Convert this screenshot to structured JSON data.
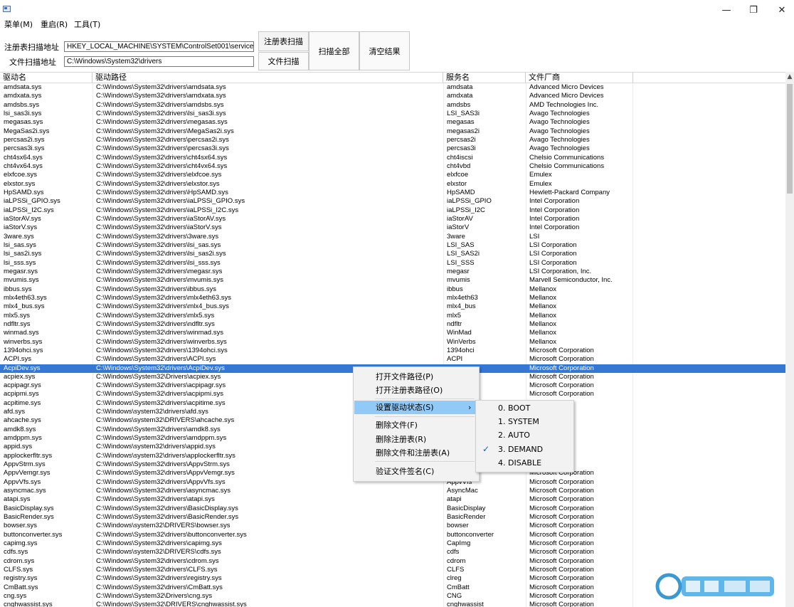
{
  "window": {
    "minimize": "—",
    "restore": "❐",
    "close": "✕"
  },
  "menu": {
    "items": [
      "菜单(M)",
      "重启(R)",
      "工具(T)"
    ]
  },
  "scan": {
    "registry_label": "注册表扫描地址",
    "registry_path": "HKEY_LOCAL_MACHINE\\SYSTEM\\ControlSet001\\services",
    "file_label": "文件扫描地址",
    "file_path": "C:\\Windows\\System32\\drivers",
    "btn_registry_scan": "注册表扫描",
    "btn_file_scan": "文件扫描",
    "btn_scan_all": "扫描全部",
    "btn_clear": "清空结果"
  },
  "table": {
    "columns": [
      "驱动名",
      "驱动路径",
      "服务名",
      "文件厂商"
    ],
    "rows": [
      [
        "amdsata.sys",
        "C:\\Windows\\System32\\drivers\\amdsata.sys",
        "amdsata",
        "Advanced Micro Devices"
      ],
      [
        "amdxata.sys",
        "C:\\Windows\\System32\\drivers\\amdxata.sys",
        "amdxata",
        "Advanced Micro Devices"
      ],
      [
        "amdsbs.sys",
        "C:\\Windows\\System32\\drivers\\amdsbs.sys",
        "amdsbs",
        "AMD Technologies Inc."
      ],
      [
        "lsi_sas3i.sys",
        "C:\\Windows\\System32\\drivers\\lsi_sas3i.sys",
        "LSI_SAS3i",
        "Avago Technologies"
      ],
      [
        "megasas.sys",
        "C:\\Windows\\System32\\drivers\\megasas.sys",
        "megasas",
        "Avago Technologies"
      ],
      [
        "MegaSas2i.sys",
        "C:\\Windows\\System32\\drivers\\MegaSas2i.sys",
        "megasas2i",
        "Avago Technologies"
      ],
      [
        "percsas2i.sys",
        "C:\\Windows\\System32\\drivers\\percsas2i.sys",
        "percsas2i",
        "Avago Technologies"
      ],
      [
        "percsas3i.sys",
        "C:\\Windows\\System32\\drivers\\percsas3i.sys",
        "percsas3i",
        "Avago Technologies"
      ],
      [
        "cht4sx64.sys",
        "C:\\Windows\\System32\\drivers\\cht4sx64.sys",
        "cht4iscsi",
        "Chelsio Communications"
      ],
      [
        "cht4vx64.sys",
        "C:\\Windows\\System32\\drivers\\cht4vx64.sys",
        "cht4vbd",
        "Chelsio Communications"
      ],
      [
        "elxfcoe.sys",
        "C:\\Windows\\System32\\drivers\\elxfcoe.sys",
        "elxfcoe",
        "Emulex"
      ],
      [
        "elxstor.sys",
        "C:\\Windows\\System32\\drivers\\elxstor.sys",
        "elxstor",
        "Emulex"
      ],
      [
        "HpSAMD.sys",
        "C:\\Windows\\System32\\drivers\\HpSAMD.sys",
        "HpSAMD",
        "Hewlett-Packard Company"
      ],
      [
        "iaLPSSi_GPIO.sys",
        "C:\\Windows\\System32\\drivers\\iaLPSSi_GPIO.sys",
        "iaLPSSi_GPIO",
        "Intel Corporation"
      ],
      [
        "iaLPSSi_I2C.sys",
        "C:\\Windows\\System32\\drivers\\iaLPSSi_I2C.sys",
        "iaLPSSi_I2C",
        "Intel Corporation"
      ],
      [
        "iaStorAV.sys",
        "C:\\Windows\\System32\\drivers\\iaStorAV.sys",
        "iaStorAV",
        "Intel Corporation"
      ],
      [
        "iaStorV.sys",
        "C:\\Windows\\System32\\drivers\\iaStorV.sys",
        "iaStorV",
        "Intel Corporation"
      ],
      [
        "3ware.sys",
        "C:\\Windows\\System32\\drivers\\3ware.sys",
        "3ware",
        "LSI"
      ],
      [
        "lsi_sas.sys",
        "C:\\Windows\\System32\\drivers\\lsi_sas.sys",
        "LSI_SAS",
        "LSI Corporation"
      ],
      [
        "lsi_sas2i.sys",
        "C:\\Windows\\System32\\drivers\\lsi_sas2i.sys",
        "LSI_SAS2i",
        "LSI Corporation"
      ],
      [
        "lsi_sss.sys",
        "C:\\Windows\\System32\\drivers\\lsi_sss.sys",
        "LSI_SSS",
        "LSI Corporation"
      ],
      [
        "megasr.sys",
        "C:\\Windows\\System32\\drivers\\megasr.sys",
        "megasr",
        "LSI Corporation, Inc."
      ],
      [
        "mvumis.sys",
        "C:\\Windows\\System32\\drivers\\mvumis.sys",
        "mvumis",
        "Marvell Semiconductor, Inc."
      ],
      [
        "ibbus.sys",
        "C:\\Windows\\System32\\drivers\\ibbus.sys",
        "ibbus",
        "Mellanox"
      ],
      [
        "mlx4eth63.sys",
        "C:\\Windows\\System32\\drivers\\mlx4eth63.sys",
        "mlx4eth63",
        "Mellanox"
      ],
      [
        "mlx4_bus.sys",
        "C:\\Windows\\System32\\drivers\\mlx4_bus.sys",
        "mlx4_bus",
        "Mellanox"
      ],
      [
        "mlx5.sys",
        "C:\\Windows\\System32\\drivers\\mlx5.sys",
        "mlx5",
        "Mellanox"
      ],
      [
        "ndfltr.sys",
        "C:\\Windows\\System32\\drivers\\ndfltr.sys",
        "ndfltr",
        "Mellanox"
      ],
      [
        "winmad.sys",
        "C:\\Windows\\System32\\drivers\\winmad.sys",
        "WinMad",
        "Mellanox"
      ],
      [
        "winverbs.sys",
        "C:\\Windows\\System32\\drivers\\winverbs.sys",
        "WinVerbs",
        "Mellanox"
      ],
      [
        "1394ohci.sys",
        "C:\\Windows\\System32\\drivers\\1394ohci.sys",
        "1394ohci",
        "Microsoft Corporation"
      ],
      [
        "ACPI.sys",
        "C:\\Windows\\System32\\drivers\\ACPI.sys",
        "ACPI",
        "Microsoft Corporation"
      ],
      [
        "AcpiDev.sys",
        "C:\\Windows\\System32\\drivers\\AcpiDev.sys",
        "",
        "Microsoft Corporation"
      ],
      [
        "acpiex.sys",
        "C:\\Windows\\System32\\Drivers\\acpiex.sys",
        "",
        "Microsoft Corporation"
      ],
      [
        "acpipagr.sys",
        "C:\\Windows\\System32\\drivers\\acpipagr.sys",
        "",
        "Microsoft Corporation"
      ],
      [
        "acpipmi.sys",
        "C:\\Windows\\System32\\drivers\\acpipmi.sys",
        "",
        "Microsoft Corporation"
      ],
      [
        "acpitime.sys",
        "C:\\Windows\\System32\\drivers\\acpitime.sys",
        "",
        "oration"
      ],
      [
        "afd.sys",
        "C:\\Windows\\system32\\drivers\\afd.sys",
        "",
        "oration"
      ],
      [
        "ahcache.sys",
        "C:\\Windows\\system32\\DRIVERS\\ahcache.sys",
        "",
        "oration"
      ],
      [
        "amdk8.sys",
        "C:\\Windows\\System32\\drivers\\amdk8.sys",
        "",
        "oration"
      ],
      [
        "amdppm.sys",
        "C:\\Windows\\System32\\drivers\\amdppm.sys",
        "",
        "oration"
      ],
      [
        "appid.sys",
        "C:\\Windows\\system32\\drivers\\appid.sys",
        "",
        "oration"
      ],
      [
        "applockerfltr.sys",
        "C:\\Windows\\system32\\drivers\\applockerfltr.sys",
        "",
        "oration"
      ],
      [
        "AppvStrm.sys",
        "C:\\Windows\\System32\\drivers\\AppvStrm.sys",
        "",
        "oration"
      ],
      [
        "AppvVemgr.sys",
        "C:\\Windows\\System32\\drivers\\AppvVemgr.sys",
        "",
        "Microsoft Corporation"
      ],
      [
        "AppvVfs.sys",
        "C:\\Windows\\System32\\drivers\\AppvVfs.sys",
        "AppvVfs",
        "Microsoft Corporation"
      ],
      [
        "asyncmac.sys",
        "C:\\Windows\\System32\\drivers\\asyncmac.sys",
        "AsyncMac",
        "Microsoft Corporation"
      ],
      [
        "atapi.sys",
        "C:\\Windows\\System32\\drivers\\atapi.sys",
        "atapi",
        "Microsoft Corporation"
      ],
      [
        "BasicDisplay.sys",
        "C:\\Windows\\System32\\drivers\\BasicDisplay.sys",
        "BasicDisplay",
        "Microsoft Corporation"
      ],
      [
        "BasicRender.sys",
        "C:\\Windows\\System32\\drivers\\BasicRender.sys",
        "BasicRender",
        "Microsoft Corporation"
      ],
      [
        "bowser.sys",
        "C:\\Windows\\system32\\DRIVERS\\bowser.sys",
        "bowser",
        "Microsoft Corporation"
      ],
      [
        "buttonconverter.sys",
        "C:\\Windows\\System32\\drivers\\buttonconverter.sys",
        "buttonconverter",
        "Microsoft Corporation"
      ],
      [
        "capimg.sys",
        "C:\\Windows\\System32\\drivers\\capimg.sys",
        "CapImg",
        "Microsoft Corporation"
      ],
      [
        "cdfs.sys",
        "C:\\Windows\\system32\\DRIVERS\\cdfs.sys",
        "cdfs",
        "Microsoft Corporation"
      ],
      [
        "cdrom.sys",
        "C:\\Windows\\System32\\drivers\\cdrom.sys",
        "cdrom",
        "Microsoft Corporation"
      ],
      [
        "CLFS.sys",
        "C:\\Windows\\System32\\drivers\\CLFS.sys",
        "CLFS",
        "Microsoft Corporation"
      ],
      [
        "registry.sys",
        "C:\\Windows\\System32\\drivers\\registry.sys",
        "clreg",
        "Microsoft Corporation"
      ],
      [
        "CmBatt.sys",
        "C:\\Windows\\System32\\drivers\\CmBatt.sys",
        "CmBatt",
        "Microsoft Corporation"
      ],
      [
        "cng.sys",
        "C:\\Windows\\System32\\Drivers\\cng.sys",
        "CNG",
        "Microsoft Corporation"
      ],
      [
        "cnghwassist.sys",
        "C:\\Windows\\System32\\DRIVERS\\cnghwassist.sys",
        "cnghwassist",
        "Microsoft Corporation"
      ]
    ],
    "selected_row": 32
  },
  "context_menu": {
    "items": [
      "打开文件路径(P)",
      "打开注册表路径(O)",
      "设置驱动状态(S)",
      "删除文件(F)",
      "删除注册表(R)",
      "删除文件和注册表(A)",
      "验证文件签名(C)"
    ],
    "submenu_arrow": "›"
  },
  "submenu": {
    "items": [
      "0. BOOT",
      "1. SYSTEM",
      "2. AUTO",
      "3. DEMAND",
      "4. DISABLE"
    ],
    "checked_index": 3,
    "check_mark": "✓"
  },
  "scroll_up_arrow": "▲",
  "colors": {
    "selection": "#3478d4",
    "menu_highlight": "#91c9f7"
  }
}
